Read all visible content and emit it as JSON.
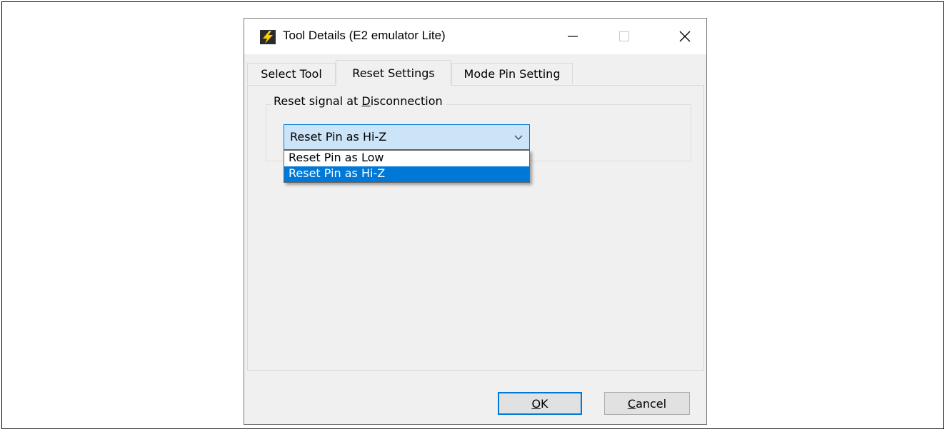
{
  "window": {
    "title": "Tool Details (E2 emulator Lite)",
    "controls": [
      "minimize-icon",
      "maximize-icon",
      "close-icon"
    ]
  },
  "tabs": [
    {
      "label": "Select Tool",
      "active": false
    },
    {
      "label": "Reset Settings",
      "active": true
    },
    {
      "label": "Mode Pin Setting",
      "active": false
    }
  ],
  "group": {
    "label_prefix": "Reset signal at ",
    "label_mnemonic": "D",
    "label_suffix": "isconnection"
  },
  "combo": {
    "value": "Reset Pin as Hi-Z",
    "options": [
      "Reset Pin as Low",
      "Reset Pin as Hi-Z"
    ],
    "selected_index": 1
  },
  "buttons": {
    "ok_mnemonic": "O",
    "ok_suffix": "K",
    "cancel_mnemonic": "C",
    "cancel_suffix": "ancel"
  },
  "colors": {
    "accent": "#0078d7",
    "combo_bg": "#cce4f7",
    "dialog_bg": "#f0f0f0"
  }
}
